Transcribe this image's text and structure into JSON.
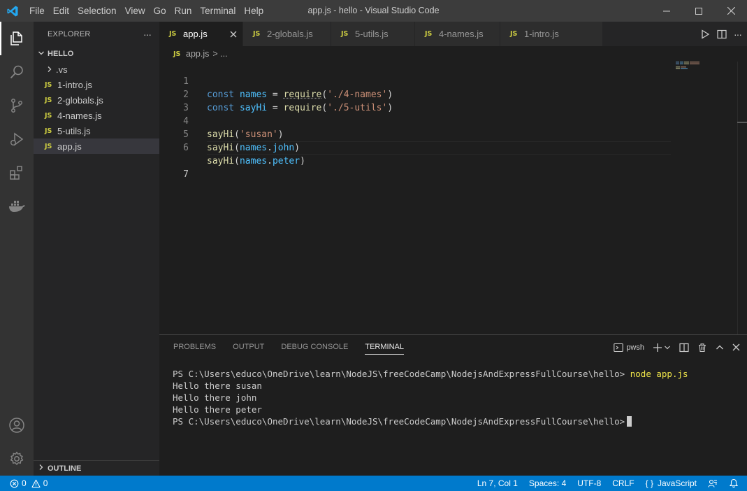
{
  "titlebar": {
    "menu": [
      "File",
      "Edit",
      "Selection",
      "View",
      "Go",
      "Run",
      "Terminal",
      "Help"
    ],
    "title": "app.js - hello - Visual Studio Code"
  },
  "activitybar": {
    "icons": [
      "explorer-icon",
      "search-icon",
      "source-control-icon",
      "run-debug-icon",
      "extensions-icon",
      "docker-icon",
      "account-icon",
      "manage-gear-icon"
    ]
  },
  "sidebar": {
    "header": "EXPLORER",
    "more": "···",
    "folder": "HELLO",
    "items": [
      {
        "label": ".vs",
        "type": "folder"
      },
      {
        "label": "1-intro.js",
        "type": "js"
      },
      {
        "label": "2-globals.js",
        "type": "js"
      },
      {
        "label": "4-names.js",
        "type": "js"
      },
      {
        "label": "5-utils.js",
        "type": "js"
      },
      {
        "label": "app.js",
        "type": "js"
      }
    ],
    "js_badge": "JS",
    "outline": "OUTLINE"
  },
  "editor": {
    "tabs": [
      {
        "label": "app.js",
        "active": true
      },
      {
        "label": "2-globals.js",
        "active": false
      },
      {
        "label": "5-utils.js",
        "active": false
      },
      {
        "label": "4-names.js",
        "active": false
      },
      {
        "label": "1-intro.js",
        "active": false
      }
    ],
    "breadcrumb": {
      "file": "app.js",
      "rest": "> ..."
    },
    "line_numbers": [
      "1",
      "2",
      "3",
      "4",
      "5",
      "6",
      "7"
    ],
    "code": {
      "l1": {
        "kw": "const",
        "var": "names",
        "eq": " = ",
        "fn": "require",
        "open": "(",
        "str": "'./4-names'",
        "close": ")"
      },
      "l2": {
        "kw": "const",
        "var": "sayHi",
        "eq": " = ",
        "fn": "require",
        "open": "(",
        "str": "'./5-utils'",
        "close": ")"
      },
      "l4": {
        "fn": "sayHi",
        "open": "(",
        "str": "'susan'",
        "close": ")"
      },
      "l5": {
        "fn": "sayHi",
        "open": "(",
        "obj": "names",
        "dot": ".",
        "prop": "john",
        "close": ")"
      },
      "l6": {
        "fn": "sayHi",
        "open": "(",
        "obj": "names",
        "dot": ".",
        "prop": "peter",
        "close": ")"
      }
    }
  },
  "panel": {
    "tabs": [
      "PROBLEMS",
      "OUTPUT",
      "DEBUG CONSOLE",
      "TERMINAL"
    ],
    "active_tab": "TERMINAL",
    "shell": "pwsh",
    "terminal": {
      "prompt": "PS C:\\Users\\educo\\OneDrive\\learn\\NodeJS\\freeCodeCamp\\NodejsAndExpressFullCourse\\hello>",
      "command": "node app.js",
      "output": [
        "Hello there susan",
        "Hello there john",
        "Hello there peter"
      ]
    }
  },
  "statusbar": {
    "errors": "0",
    "warnings": "0",
    "position": "Ln 7, Col 1",
    "spaces": "Spaces: 4",
    "encoding": "UTF-8",
    "eol": "CRLF",
    "language": "JavaScript",
    "language_icon": "{ }"
  },
  "colors": {
    "statusbar": "#007acc",
    "titlebar": "#3c3c3c",
    "activitybar": "#333333",
    "sidebar": "#252526",
    "editor": "#1e1e1e",
    "js_badge": "#cbcb41"
  }
}
